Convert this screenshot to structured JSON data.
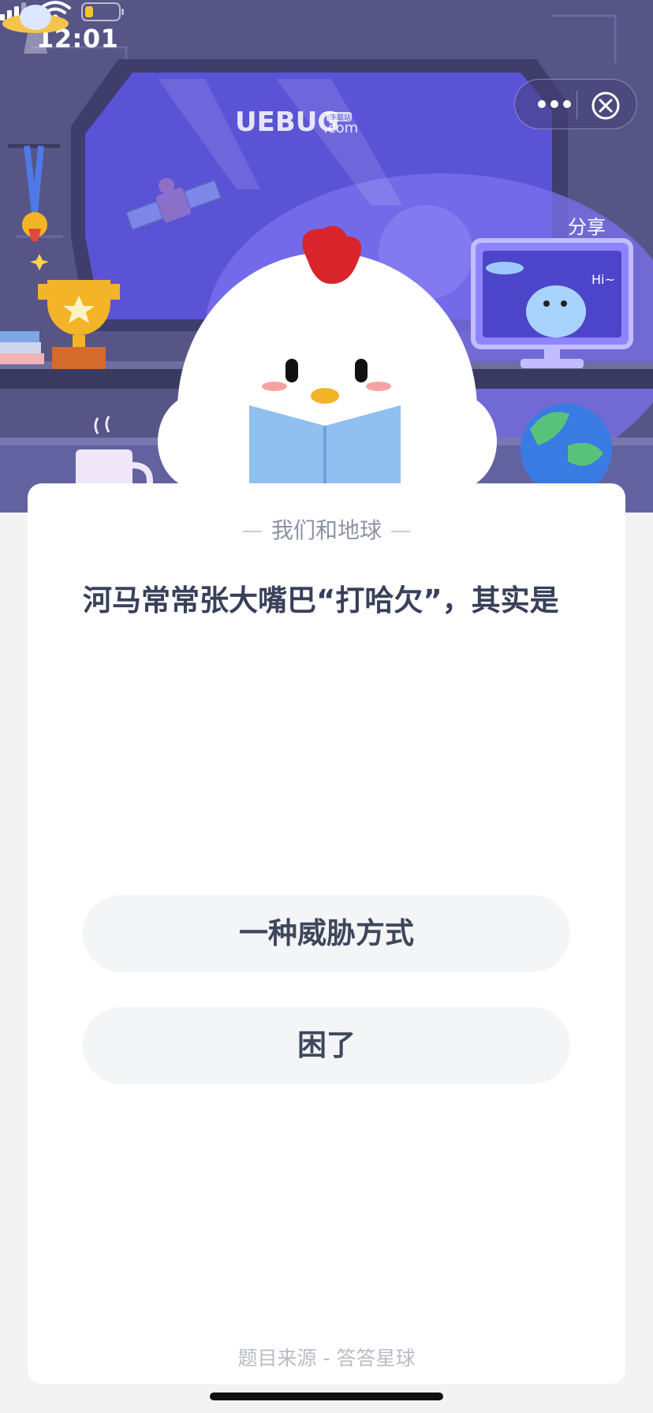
{
  "status_bar": {
    "time": "12:01"
  },
  "banner": {
    "watermark": "UEBUG",
    "watermark_suffix": ".com",
    "watermark_badge": "下载站",
    "bubble_text": "Hi~"
  },
  "capsule": {
    "share_label": "分享"
  },
  "quiz": {
    "category": "我们和地球",
    "question": "河马常常张大嘴巴“打哈欠”，其实是",
    "options": [
      {
        "label": "一种威胁方式"
      },
      {
        "label": "困了"
      }
    ],
    "source": "题目来源 - 答答星球"
  },
  "colors": {
    "hero_bg": "#565586",
    "card_bg": "#ffffff",
    "question_text": "#38405a",
    "option_bg": "#f4f5f7"
  }
}
